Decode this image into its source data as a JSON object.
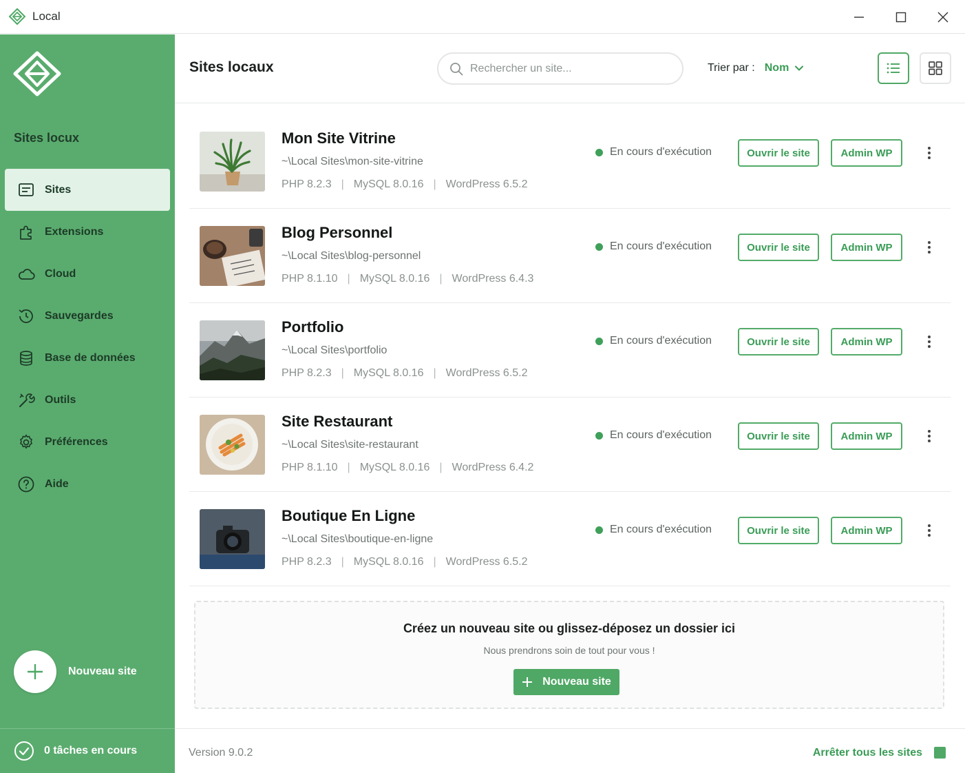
{
  "window": {
    "title": "Local",
    "controls": [
      "minimize",
      "maximize",
      "close"
    ]
  },
  "colors": {
    "sidebar_bg": "#5aac6e",
    "accent": "#4fa865",
    "accent_text": "#3a9c56",
    "status_running": "#3fa05a"
  },
  "sidebar": {
    "section_title": "Sites locux",
    "items": [
      {
        "label": "Sites",
        "icon": "sites-icon",
        "active": true
      },
      {
        "label": "Extensions",
        "icon": "extensions-icon",
        "active": false
      },
      {
        "label": "Cloud",
        "icon": "cloud-icon",
        "active": false
      },
      {
        "label": "Sauvegardes",
        "icon": "backup-icon",
        "active": false
      },
      {
        "label": "Base de données",
        "icon": "database-icon",
        "active": false
      },
      {
        "label": "Outils",
        "icon": "tools-icon",
        "active": false
      },
      {
        "label": "Préférences",
        "icon": "gear-icon",
        "active": false
      },
      {
        "label": "Aide",
        "icon": "help-icon",
        "active": false
      }
    ],
    "new_site_label": "Nouveau site",
    "tasks_label": "0 tâches en cours"
  },
  "header": {
    "title": "Sites locaux",
    "search_placeholder": "Rechercher un site...",
    "sort_label": "Trier par :",
    "sort_value": "Nom"
  },
  "sites": [
    {
      "name": "Mon Site Vitrine",
      "path": "~\\Local Sites\\mon-site-vitrine",
      "php": "PHP 8.2.3",
      "mysql": "MySQL 8.0.16",
      "wordpress": "WordPress 6.5.2",
      "status": "En cours d'exécution",
      "thumbnail": "plant-photo"
    },
    {
      "name": "Blog Personnel",
      "path": "~\\Local Sites\\blog-personnel",
      "php": "PHP 8.1.10",
      "mysql": "MySQL 8.0.16",
      "wordpress": "WordPress 6.4.3",
      "status": "En cours d'exécution",
      "thumbnail": "desk-coffee-photo"
    },
    {
      "name": "Portfolio",
      "path": "~\\Local Sites\\portfolio",
      "php": "PHP 8.2.3",
      "mysql": "MySQL 8.0.16",
      "wordpress": "WordPress 6.5.2",
      "status": "En cours d'exécution",
      "thumbnail": "mountain-photo"
    },
    {
      "name": "Site Restaurant",
      "path": "~\\Local Sites\\site-restaurant",
      "php": "PHP 8.1.10",
      "mysql": "MySQL 8.0.16",
      "wordpress": "WordPress 6.4.2",
      "status": "En cours d'exécution",
      "thumbnail": "food-plate-photo"
    },
    {
      "name": "Boutique En Ligne",
      "path": "~\\Local Sites\\boutique-en-ligne",
      "php": "PHP 8.2.3",
      "mysql": "MySQL 8.0.16",
      "wordpress": "WordPress 6.5.2",
      "status": "En cours d'exécution",
      "thumbnail": "camera-photo"
    }
  ],
  "site_actions": {
    "open_label": "Ouvrir le site",
    "admin_label": "Admin WP"
  },
  "dropzone": {
    "title": "Créez un nouveau site ou glissez-déposez un dossier ici",
    "subtitle": "Nous prendrons soin de tout pour vous !",
    "button_label": "Nouveau site"
  },
  "footer": {
    "version": "Version 9.0.2",
    "stop_all_label": "Arrêter tous les sites"
  }
}
